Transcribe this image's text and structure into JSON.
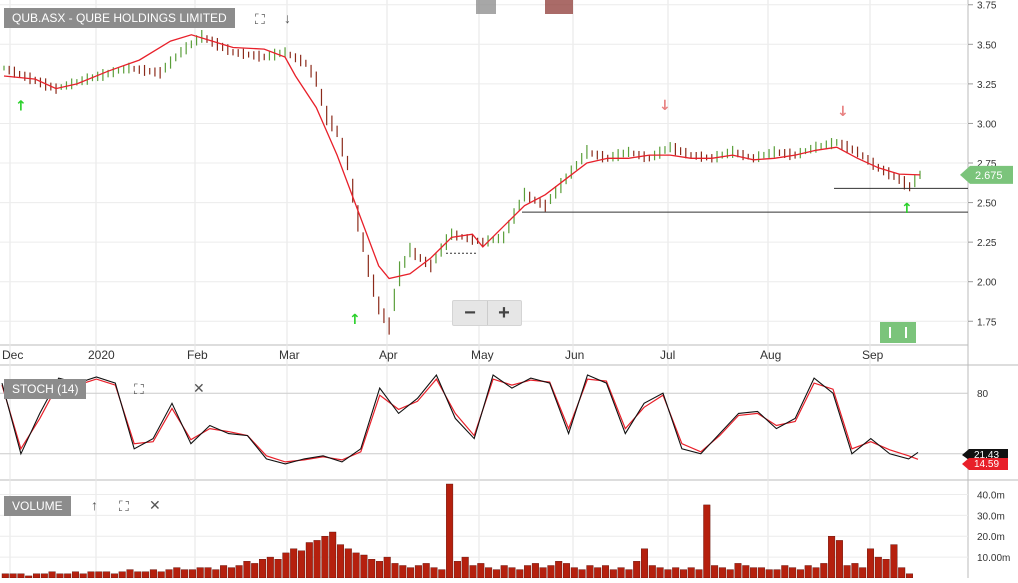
{
  "header": {
    "symbol_label": "QUB.ASX - QUBE HOLDINGS LIMITED",
    "stoch_label": "STOCH (14)",
    "volume_label": "VOLUME"
  },
  "icons": {
    "fullscreen": "expand-icon",
    "download": "arrow-down-icon",
    "close": "close-icon",
    "up": "arrow-up-icon"
  },
  "zoom": {
    "minus": "−",
    "plus": "+"
  },
  "colors": {
    "ma_line": "#e8202a",
    "stoch_k": "#111111",
    "stoch_d": "#e8202a",
    "up_bar": "#5a9e3a",
    "down_bar": "#8b2a1a",
    "volume_bar": "#b5200e",
    "buy_arrow": "#2cd12c",
    "sell_arrow": "#e88080",
    "price_badge": "#7bc47b"
  },
  "chart_data": [
    {
      "type": "line",
      "title": "QUB.ASX - QUBE HOLDINGS LIMITED",
      "x_tick_labels": [
        "Dec",
        "2020",
        "Feb",
        "Mar",
        "Apr",
        "May",
        "Jun",
        "Jul",
        "Aug",
        "Sep"
      ],
      "y_tick_labels": [
        "3.75",
        "3.50",
        "3.25",
        "3.00",
        "2.75",
        "2.50",
        "2.25",
        "2.00",
        "1.75"
      ],
      "ylim": [
        1.6,
        3.78
      ],
      "grid": true,
      "last_price": "2.675",
      "series": [
        {
          "name": "",
          "role": "price_close",
          "points": [
            [
              0,
              3.35
            ],
            [
              5,
              3.22
            ],
            [
              8,
              3.28
            ],
            [
              12,
              3.35
            ],
            [
              15,
              3.32
            ],
            [
              17,
              3.45
            ],
            [
              19,
              3.55
            ],
            [
              22,
              3.45
            ],
            [
              25,
              3.42
            ],
            [
              27,
              3.45
            ],
            [
              29,
              3.38
            ],
            [
              30,
              3.28
            ],
            [
              31,
              3.05
            ],
            [
              32,
              2.95
            ],
            [
              33,
              2.75
            ],
            [
              34,
              2.4
            ],
            [
              35,
              2.1
            ],
            [
              36,
              1.85
            ],
            [
              37,
              1.72
            ],
            [
              38,
              2.05
            ],
            [
              39,
              2.2
            ],
            [
              41,
              2.1
            ],
            [
              43,
              2.3
            ],
            [
              46,
              2.25
            ],
            [
              48,
              2.28
            ],
            [
              50,
              2.55
            ],
            [
              52,
              2.48
            ],
            [
              54,
              2.65
            ],
            [
              56,
              2.82
            ],
            [
              58,
              2.78
            ],
            [
              60,
              2.82
            ],
            [
              62,
              2.78
            ],
            [
              64,
              2.85
            ],
            [
              66,
              2.8
            ],
            [
              68,
              2.78
            ],
            [
              70,
              2.82
            ],
            [
              72,
              2.78
            ],
            [
              74,
              2.82
            ],
            [
              76,
              2.8
            ],
            [
              78,
              2.85
            ],
            [
              80,
              2.88
            ],
            [
              82,
              2.82
            ],
            [
              84,
              2.72
            ],
            [
              86,
              2.65
            ],
            [
              87,
              2.6
            ],
            [
              88,
              2.675
            ]
          ]
        },
        {
          "name": "",
          "role": "moving_average",
          "points": [
            [
              0,
              3.3
            ],
            [
              3,
              3.28
            ],
            [
              5,
              3.22
            ],
            [
              7,
              3.25
            ],
            [
              10,
              3.33
            ],
            [
              13,
              3.4
            ],
            [
              16,
              3.52
            ],
            [
              18,
              3.56
            ],
            [
              20,
              3.52
            ],
            [
              22,
              3.48
            ],
            [
              25,
              3.47
            ],
            [
              27,
              3.42
            ],
            [
              28,
              3.3
            ],
            [
              30,
              3.1
            ],
            [
              32,
              2.8
            ],
            [
              34,
              2.45
            ],
            [
              36,
              2.1
            ],
            [
              37,
              2.02
            ],
            [
              39,
              2.05
            ],
            [
              41,
              2.15
            ],
            [
              43,
              2.28
            ],
            [
              45,
              2.3
            ],
            [
              46,
              2.22
            ],
            [
              48,
              2.35
            ],
            [
              50,
              2.48
            ],
            [
              52,
              2.55
            ],
            [
              54,
              2.65
            ],
            [
              56,
              2.75
            ],
            [
              58,
              2.78
            ],
            [
              60,
              2.78
            ],
            [
              62,
              2.8
            ],
            [
              64,
              2.8
            ],
            [
              66,
              2.78
            ],
            [
              68,
              2.78
            ],
            [
              70,
              2.8
            ],
            [
              72,
              2.77
            ],
            [
              74,
              2.78
            ],
            [
              76,
              2.8
            ],
            [
              78,
              2.83
            ],
            [
              80,
              2.85
            ],
            [
              82,
              2.78
            ],
            [
              84,
              2.72
            ],
            [
              86,
              2.68
            ],
            [
              88,
              2.675
            ]
          ]
        }
      ],
      "horizontal_lines": [
        2.59,
        2.44
      ]
    },
    {
      "type": "line",
      "title": "STOCH (14)",
      "y_tick_labels": [
        "80"
      ],
      "ylim": [
        0,
        100
      ],
      "level_lines": [
        80,
        20
      ],
      "readouts": [
        "21.43",
        "14.59"
      ],
      "series": [
        {
          "name": "",
          "role": "k_line",
          "points": [
            [
              0,
              90
            ],
            [
              2,
              20
            ],
            [
              4,
              60
            ],
            [
              6,
              95
            ],
            [
              8,
              90
            ],
            [
              10,
              96
            ],
            [
              12,
              90
            ],
            [
              14,
              25
            ],
            [
              16,
              35
            ],
            [
              18,
              70
            ],
            [
              20,
              30
            ],
            [
              22,
              48
            ],
            [
              24,
              40
            ],
            [
              26,
              38
            ],
            [
              28,
              15
            ],
            [
              30,
              10
            ],
            [
              32,
              15
            ],
            [
              34,
              18
            ],
            [
              36,
              12
            ],
            [
              38,
              25
            ],
            [
              40,
              85
            ],
            [
              42,
              60
            ],
            [
              44,
              75
            ],
            [
              46,
              98
            ],
            [
              48,
              55
            ],
            [
              50,
              35
            ],
            [
              52,
              98
            ],
            [
              54,
              85
            ],
            [
              56,
              95
            ],
            [
              58,
              90
            ],
            [
              60,
              40
            ],
            [
              62,
              98
            ],
            [
              64,
              90
            ],
            [
              66,
              40
            ],
            [
              68,
              70
            ],
            [
              70,
              80
            ],
            [
              72,
              25
            ],
            [
              74,
              20
            ],
            [
              76,
              40
            ],
            [
              78,
              60
            ],
            [
              80,
              62
            ],
            [
              82,
              45
            ],
            [
              84,
              55
            ],
            [
              86,
              95
            ],
            [
              88,
              80
            ],
            [
              90,
              20
            ],
            [
              92,
              35
            ],
            [
              94,
              20
            ],
            [
              96,
              15
            ],
            [
              97,
              21.43
            ]
          ]
        },
        {
          "name": "",
          "role": "d_line",
          "points": [
            [
              0,
              88
            ],
            [
              2,
              25
            ],
            [
              4,
              55
            ],
            [
              6,
              90
            ],
            [
              8,
              88
            ],
            [
              10,
              94
            ],
            [
              12,
              88
            ],
            [
              14,
              30
            ],
            [
              16,
              32
            ],
            [
              18,
              65
            ],
            [
              20,
              34
            ],
            [
              22,
              45
            ],
            [
              24,
              42
            ],
            [
              26,
              38
            ],
            [
              28,
              18
            ],
            [
              30,
              12
            ],
            [
              32,
              14
            ],
            [
              34,
              17
            ],
            [
              36,
              14
            ],
            [
              38,
              22
            ],
            [
              40,
              78
            ],
            [
              42,
              64
            ],
            [
              44,
              72
            ],
            [
              46,
              94
            ],
            [
              48,
              60
            ],
            [
              50,
              38
            ],
            [
              52,
              94
            ],
            [
              54,
              88
            ],
            [
              56,
              93
            ],
            [
              58,
              91
            ],
            [
              60,
              45
            ],
            [
              62,
              94
            ],
            [
              64,
              92
            ],
            [
              66,
              45
            ],
            [
              68,
              66
            ],
            [
              70,
              78
            ],
            [
              72,
              30
            ],
            [
              74,
              22
            ],
            [
              76,
              38
            ],
            [
              78,
              58
            ],
            [
              80,
              60
            ],
            [
              82,
              48
            ],
            [
              84,
              52
            ],
            [
              86,
              90
            ],
            [
              88,
              84
            ],
            [
              90,
              25
            ],
            [
              92,
              32
            ],
            [
              94,
              24
            ],
            [
              96,
              18
            ],
            [
              97,
              14.59
            ]
          ]
        }
      ]
    },
    {
      "type": "bar",
      "title": "VOLUME",
      "y_tick_labels": [
        "40.0m",
        "30.0m",
        "20.0m",
        "10.00m"
      ],
      "ylim": [
        0,
        45
      ],
      "values": [
        2,
        2,
        2,
        1,
        2,
        2,
        3,
        2,
        2,
        3,
        2,
        3,
        3,
        3,
        2,
        3,
        4,
        3,
        3,
        4,
        3,
        4,
        5,
        4,
        4,
        5,
        5,
        4,
        6,
        5,
        6,
        8,
        7,
        9,
        10,
        9,
        12,
        14,
        13,
        17,
        18,
        20,
        22,
        16,
        14,
        12,
        11,
        9,
        8,
        10,
        7,
        6,
        5,
        6,
        7,
        5,
        4,
        45,
        8,
        10,
        6,
        7,
        5,
        4,
        6,
        5,
        4,
        6,
        7,
        5,
        6,
        8,
        7,
        5,
        4,
        6,
        5,
        6,
        4,
        5,
        4,
        8,
        14,
        6,
        5,
        4,
        5,
        4,
        5,
        4,
        35,
        6,
        5,
        4,
        7,
        6,
        5,
        5,
        4,
        4,
        6,
        5,
        4,
        6,
        5,
        7,
        20,
        18,
        6,
        7,
        5,
        14,
        10,
        9,
        16,
        5,
        2
      ]
    }
  ]
}
